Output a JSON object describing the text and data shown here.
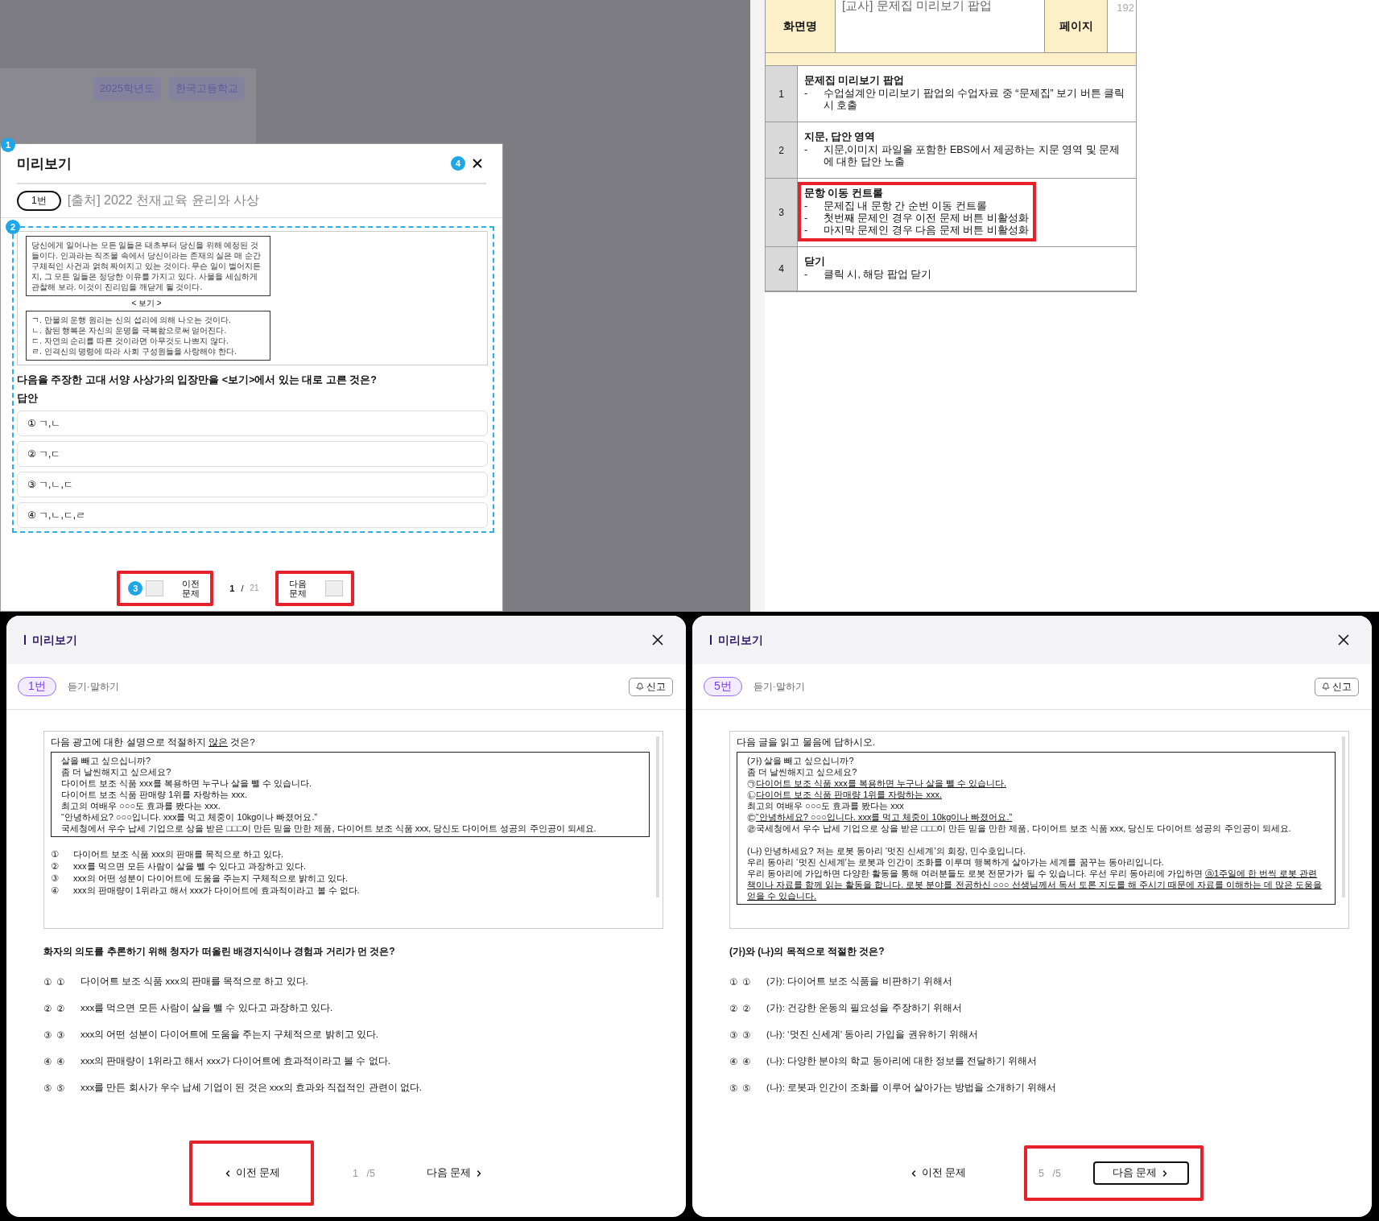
{
  "background": {
    "chips": [
      "2025학년도",
      "한국고등학교"
    ]
  },
  "teacher_popup": {
    "badge": "1",
    "title": "미리보기",
    "close_badge": "4",
    "number": "1번",
    "source": "[출처] 2022 천재교육 윤리와 사상",
    "content_badge": "2",
    "passage": "당신에게 일어나는 모든 일들은 태초부터 당신을 위해 예정된 것들이다. 인과라는 직조물 속에서 당신이라는 존재의 실은 매 순간 구체적인 사건과 얽혀 짜여지고 있는 것이다. 무슨 일이 벌어지든지, 그 모든 일들은 정당한 이유를 가지고 있다. 사물을 세심하게 관찰해 보라. 이것이 진리임을 깨닫게 될 것이다.",
    "bogi_label": "< 보기 >",
    "bogi_items": [
      "ㄱ. 만물의 운행 원리는 신의 섭리에 의해 나오는 것이다.",
      "ㄴ. 참된 행복은 자신의 운명을 극복함으로써 얻어진다.",
      "ㄷ. 자연의 순리를 따른 것이라면 아무것도 나쁘지 않다.",
      "ㄹ. 인격신의 명령에 따라 사회 구성원들을 사랑해야 한다."
    ],
    "question": "다음을 주장한 고대 서양 사상가의 입장만을 <보기>에서 있는 대로 고른 것은?",
    "answer_label": "답안",
    "answers": [
      "① ㄱ,ㄴ",
      "② ㄱ,ㄷ",
      "③ ㄱ,ㄴ,ㄷ",
      "④ ㄱ,ㄴ,ㄷ,ㄹ"
    ],
    "nav": {
      "badge": "3",
      "prev": "이전 문제",
      "current": "1",
      "separator": "/",
      "total": "21",
      "next": "다음 문제",
      "prev_highlighted": true,
      "next_highlighted": true
    }
  },
  "spec": {
    "label": "화면명",
    "title": "[교사] 문제집 미리보기 팝업",
    "page_label": "페이지",
    "page": "192",
    "bullet": "-",
    "rows": [
      {
        "number": "1",
        "title": "문제집 미리보기 팝업",
        "items": [
          "수업설계안 미리보기 팝업의 수업자료 중 “문제집” 보기 버튼 클릭 시 호출"
        ],
        "highlighted": false
      },
      {
        "number": "2",
        "title": "지문, 답안 영역",
        "items": [
          "지문,이미지 파일을 포함한 EBS에서 제공하는 지문 영역 및 문제에 대한 답안 노출"
        ],
        "highlighted": false
      },
      {
        "number": "3",
        "title": "문항 이동 컨트롤",
        "items": [
          "문제집 내 문항 간 순번 이동 컨트롤",
          "첫번째 문제인 경우 이전 문제 버튼 비활성화",
          "마지막 문제인 경우 다음 문제 버튼 비활성화"
        ],
        "highlighted": true
      },
      {
        "number": "4",
        "title": "닫기",
        "items": [
          "클릭 시, 해당 팝업 닫기"
        ],
        "highlighted": false
      }
    ]
  },
  "student_popups": [
    {
      "title": "미리보기",
      "number": "1번",
      "category": "듣기·말하기",
      "report": "신고",
      "instruction": [
        {
          "text": "다음 광고에 대한 설명으로 적절하지 ",
          "underlined": false
        },
        {
          "text": "않은",
          "underlined": true
        },
        {
          "text": " 것은?",
          "underlined": false
        }
      ],
      "passage": [
        [
          {
            "text": "살을 빼고 싶으십니까?",
            "underlined": false
          }
        ],
        [
          {
            "text": "좀 더 날씬해지고 싶으세요?",
            "underlined": false
          }
        ],
        [
          {
            "text": "다이어트 보조 식품 xxx를 복용하면 누구나 살을 뺄 수 있습니다.",
            "underlined": false
          }
        ],
        [
          {
            "text": "다이어트 보조 식품 판매량 1위를 자랑하는 xxx.",
            "underlined": false
          }
        ],
        [
          {
            "text": "최고의 여배우 ○○○도 효과를 봤다는 xxx.",
            "underlined": false
          }
        ],
        [
          {
            "text": "“안녕하세요? ○○○입니다. xxx를 먹고 체중이 10kg이나 빠졌어요.”",
            "underlined": false
          }
        ],
        [
          {
            "text": "국세청에서 우수 납세 기업으로 상을 받은 □□□이 만든 믿을 만한 제품, 다이어트 보조 식품 xxx, 당신도 다이어트 성공의 주인공이 되세요.",
            "underlined": false
          }
        ]
      ],
      "inline_options": [
        {
          "number": "①",
          "text": "다이어트 보조 식품 xxx의 판매를 목적으로 하고 있다."
        },
        {
          "number": "②",
          "text": "xxx를 먹으면 모든 사람이 살을 뺄 수 있다고 과장하고 있다."
        },
        {
          "number": "③",
          "text": "xxx의 어떤 성분이 다이어트에 도움을 주는지 구체적으로 밝히고 있다."
        },
        {
          "number": "④",
          "text": "xxx의 판매량이 1위라고 해서 xxx가 다이어트에 효과적이라고 볼 수 없다."
        }
      ],
      "question": "화자의 의도를 추론하기 위해 청자가 떠올린 배경지식이나 경험과 거리가 먼 것은?",
      "choices": [
        {
          "label": "①",
          "number": "①",
          "text": "다이어트 보조 식품 xxx의 판매를 목적으로 하고 있다."
        },
        {
          "label": "②",
          "number": "②",
          "text": "xxx를 먹으면 모든 사람이 살을 뺄 수 있다고 과장하고 있다."
        },
        {
          "label": "③",
          "number": "③",
          "text": "xxx의 어떤 성분이 다이어트에 도움을 주는지 구체적으로 밝히고 있다."
        },
        {
          "label": "④",
          "number": "④",
          "text": "xxx의 판매량이 1위라고 해서 xxx가 다이어트에 효과적이라고 볼 수 없다."
        },
        {
          "label": "⑤",
          "number": "⑤",
          "text": "xxx를 만든 회사가 우수 납세 기업이 된 것은 xxx의 효과와 직접적인 관련이 없다."
        }
      ],
      "nav": {
        "prev": "이전 문제",
        "current": "1",
        "total": "/5",
        "next": "다음 문제",
        "next_outlined": false,
        "prev_highlighted": true,
        "page_next_highlighted": false
      }
    },
    {
      "title": "미리보기",
      "number": "5번",
      "category": "듣기·말하기",
      "report": "신고",
      "instruction": [
        {
          "text": "다음 글을 읽고 물음에 답하시오.",
          "underlined": false
        }
      ],
      "passage": [
        [
          {
            "text": "(가) 살을 빼고 싶으십니까?",
            "underlined": false
          }
        ],
        [
          {
            "text": "좀 더 날씬해지고 싶으세요?",
            "underlined": false
          }
        ],
        [
          {
            "text": "㉠",
            "underlined": false
          },
          {
            "text": "다이어트 보조 식품 xxx를 복용하면 누구나 살을 뺄 수 있습니다.",
            "underlined": true
          }
        ],
        [
          {
            "text": "㉡",
            "underlined": false
          },
          {
            "text": "다이어트 보조 식품 판매량 1위를 자랑하는 xxx.",
            "underlined": true
          }
        ],
        [
          {
            "text": "최고의 여배우 ○○○도 효과를 봤다는 xxx",
            "underlined": false
          }
        ],
        [
          {
            "text": "㉢",
            "underlined": false
          },
          {
            "text": "“안녕하세요? ○○○입니다. xxx를 먹고 체중이 10kg이나 빠졌어요.”",
            "underlined": true
          }
        ],
        [
          {
            "text": "㉣국세청에서 우수 납세 기업으로 상을 받은 □□□이 만든 믿을 만한 제품, 다이어트 보조 식품 xxx, 당신도 다이어트 성공의 주인공이 되세요.",
            "underlined": false
          }
        ],
        [
          {
            "text": "(나) 안녕하세요? 저는 로봇 동아리 ‘멋진 신세계’의 회장, 민수호입니다.",
            "underlined": false
          }
        ],
        [
          {
            "text": "우리 동아리 ‘멋진 신세계’는 로봇과 인간이 조화를 이루며 행복하게 살아가는 세계를 꿈꾸는 동아리입니다.",
            "underlined": false
          }
        ],
        [
          {
            "text": "우리 동아리에 가입하면 다양한 활동을 통해 여러분들도 로봇 전문가가 될 수 있습니다. 우선 우리 동아리에 가입하면 ",
            "underlined": false
          },
          {
            "text": "ⓐ1주일에 한 번씩 로봇 관련 책이나 자료를 함께 읽는 활동을 합니다. 로봇 분야를 전공하신 ○○○ 선생님께서 독서 토론 지도를 해 주시기 때문에 자료를 이해하는 데 많은 도움을 얻을 수 있습니다.",
            "underlined": true
          }
        ]
      ],
      "question": "(가)와 (나)의 목적으로 적절한 것은?",
      "choices": [
        {
          "label": "①",
          "number": "①",
          "text": "(가): 다이어트 보조 식품을 비판하기 위해서"
        },
        {
          "label": "②",
          "number": "②",
          "text": "(가): 건강한 운동의 필요성을 주장하기 위해서"
        },
        {
          "label": "③",
          "number": "③",
          "text": "(나): ‘멋진 신세계’ 동아리 가입을 권유하기 위해서"
        },
        {
          "label": "④",
          "number": "④",
          "text": "(나): 다양한 분야의 학교 동아리에 대한 정보를 전달하기 위해서"
        },
        {
          "label": "⑤",
          "number": "⑤",
          "text": "(나): 로봇과 인간이 조화를 이루어 살아가는 방법을 소개하기 위해서"
        }
      ],
      "nav": {
        "prev": "이전 문제",
        "current": "5",
        "total": "/5",
        "next": "다음 문제",
        "next_outlined": true,
        "prev_highlighted": false,
        "page_next_highlighted": true
      }
    }
  ]
}
